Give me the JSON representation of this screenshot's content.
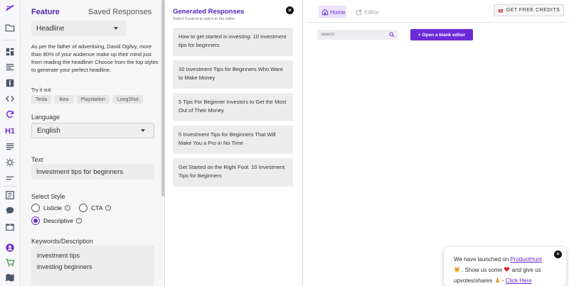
{
  "colors": {
    "accent": "#6c2bd9",
    "accent_dark": "#4a1fb8"
  },
  "rail": {
    "icons": [
      "logo-icon",
      "folder-icon",
      "dashboard-icon",
      "article-icon",
      "info-icon",
      "code-icon",
      "refresh-icon",
      "heading-icon",
      "paragraph-icon",
      "idea-icon",
      "list-icon",
      "frame-icon",
      "chat-icon",
      "gift-icon",
      "user-icon",
      "cart-icon",
      "map-icon"
    ],
    "heading_label": "H1"
  },
  "panel": {
    "tabs": {
      "feature": "Feature",
      "saved": "Saved Responses"
    },
    "feature_select": "Headline",
    "description": "As per the father of advertising, David Ogilvy, more than 80% of your audience make up their mind just from reading the headline! Choose from the top styles to generate your perfect headline.",
    "try_it_label": "Try it out:",
    "examples": [
      "Tesla",
      "Ikea",
      "Playstation",
      "LongShot"
    ],
    "language_label": "Language",
    "language_value": "English",
    "text_label": "Text",
    "text_value": "Investment tips for beginners",
    "style_label": "Select Style",
    "styles": [
      {
        "label": "Listicle",
        "selected": false
      },
      {
        "label": "CTA",
        "selected": false
      },
      {
        "label": "Descriptive",
        "selected": true
      }
    ],
    "keywords_label": "Keywords/Description",
    "keywords": [
      "investment tips",
      "investing beginners"
    ]
  },
  "generated": {
    "title": "Generated Responses",
    "subtitle": "Select Content to add it to the editor",
    "responses": [
      "How to get started in investing: 10 investment tips for beginners",
      "10 Investment Tips for Beginners Who Want to Make Money",
      "5 Tips For Beginner Investors to Get the Most Out of Their Money",
      "5 Investment Tips for Beginners That Will Make You a Pro in No Time",
      "Get Started on the Right Foot: 10 Investment Tips for Beginners"
    ]
  },
  "home": {
    "home_tab": "Home",
    "editor_tab": "Editor",
    "credits_button": "GET FREE CREDITS",
    "search_placeholder": "Search",
    "open_button": "+ Open a blank editor"
  },
  "toast": {
    "line1_prefix": "We have launched on ",
    "line1_link": "ProductHunt",
    "line2": ". Show us some",
    "line2_suffix": "and give us",
    "line3_prefix": "upvotes/shares",
    "line3_sep": "-",
    "line3_link": "Click Here"
  }
}
